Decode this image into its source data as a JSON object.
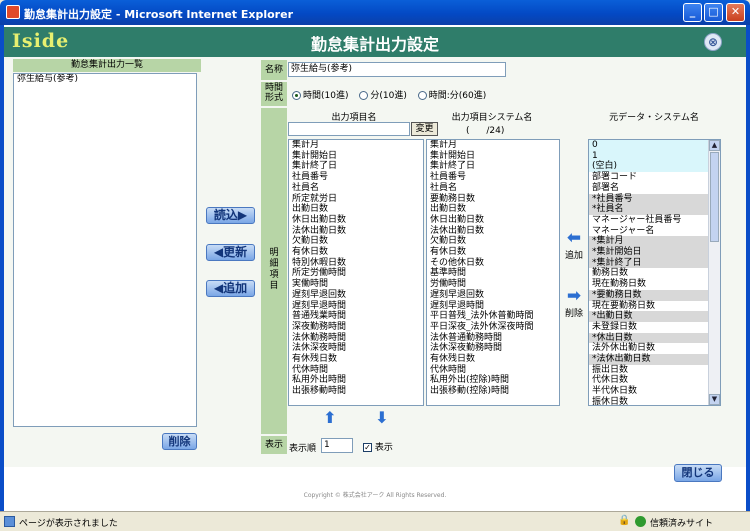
{
  "window": {
    "title": "勤怠集計出力設定 - Microsoft Internet Explorer",
    "min": "_",
    "max": "□",
    "close": "✕"
  },
  "header": {
    "logo": "Iside",
    "title": "勤怠集計出力設定",
    "close_icon": "⊗"
  },
  "left": {
    "heading": "勤怠集計出力一覧",
    "items": [
      "弥生給与(参考)"
    ],
    "delete_label": "削除"
  },
  "buttons": {
    "load": "読込▶",
    "update": "◀更新",
    "add": "◀追加"
  },
  "form": {
    "name_label": "名称",
    "name_value": "弥生給与(参考)",
    "time_label": "時間\n形式",
    "radios": [
      {
        "label": "時間(10進)",
        "on": true
      },
      {
        "label": "分(10進)",
        "on": false
      },
      {
        "label": "時間:分(60進)",
        "on": false
      }
    ],
    "detail_label": "明\n細\n項\n目"
  },
  "columns": {
    "output_name": "出力項目名",
    "output_sys": "出力項目システム名",
    "source_sys": "元データ・システム名",
    "change_label": "変更",
    "count": "( /24)"
  },
  "output_names": [
    "集計月",
    "集計開始日",
    "集計終了日",
    "社員番号",
    "社員名",
    "所定就労日",
    "出勤日数",
    "休日出勤日数",
    "法休出勤日数",
    "欠勤日数",
    "有休日数",
    "特別休暇日数",
    "所定労働時間",
    "実働時間",
    "遅刻早退回数",
    "遅刻早退時間",
    "普通残業時間",
    "深夜勤務時間",
    "法休勤務時間",
    "法休深夜時間",
    "有休残日数",
    "代休時間",
    "私用外出時間",
    "出張移動時間"
  ],
  "output_sys": [
    "集計月",
    "集計開始日",
    "集計終了日",
    "社員番号",
    "社員名",
    "要勤務日数",
    "出勤日数",
    "休日出勤日数",
    "法休出勤日数",
    "欠勤日数",
    "有休日数",
    "その他休日数",
    "基準時間",
    "労働時間",
    "遅刻早退回数",
    "遅刻早退時間",
    "平日普残_法外休普勤時間",
    "平日深夜_法外休深夜時間",
    "法休普通勤務時間",
    "法休深夜勤務時間",
    "有休残日数",
    "代休時間",
    "私用外出(控除)時間",
    "出張移動(控除)時間"
  ],
  "source_sys": [
    {
      "t": "0",
      "s": "cy"
    },
    {
      "t": "1",
      "s": "cy"
    },
    {
      "t": "(空白)",
      "s": "cy"
    },
    {
      "t": "部署コード",
      "s": ""
    },
    {
      "t": "部署名",
      "s": ""
    },
    {
      "t": "*社員番号",
      "s": "hi"
    },
    {
      "t": "*社員名",
      "s": "hi"
    },
    {
      "t": "マネージャー社員番号",
      "s": ""
    },
    {
      "t": "マネージャー名",
      "s": ""
    },
    {
      "t": "*集計月",
      "s": "hi"
    },
    {
      "t": "*集計開始日",
      "s": "hi"
    },
    {
      "t": "*集計終了日",
      "s": "hi"
    },
    {
      "t": "勤務日数",
      "s": ""
    },
    {
      "t": "現在勤務日数",
      "s": ""
    },
    {
      "t": "*要勤務日数",
      "s": "hi"
    },
    {
      "t": "現在要勤務日数",
      "s": ""
    },
    {
      "t": "*出勤日数",
      "s": "hi"
    },
    {
      "t": "未登録日数",
      "s": ""
    },
    {
      "t": "*休出日数",
      "s": "hi"
    },
    {
      "t": "法外休出勤日数",
      "s": ""
    },
    {
      "t": "*法休出勤日数",
      "s": "hi"
    },
    {
      "t": "振出日数",
      "s": ""
    },
    {
      "t": "代休日数",
      "s": ""
    },
    {
      "t": "半代休日数",
      "s": ""
    },
    {
      "t": "振休日数",
      "s": ""
    }
  ],
  "side_buttons": {
    "add": "追加",
    "remove": "削除"
  },
  "display": {
    "label": "表示",
    "order_label": "表示順",
    "order_value": "1",
    "check_label": "表示",
    "checked": "✓"
  },
  "footer": {
    "close_label": "閉じる",
    "copyright": "Copyright © 株式会社アーク All Rights Reserved."
  },
  "status": {
    "text": "ページが表示されました",
    "zone": "信頼済みサイト"
  }
}
